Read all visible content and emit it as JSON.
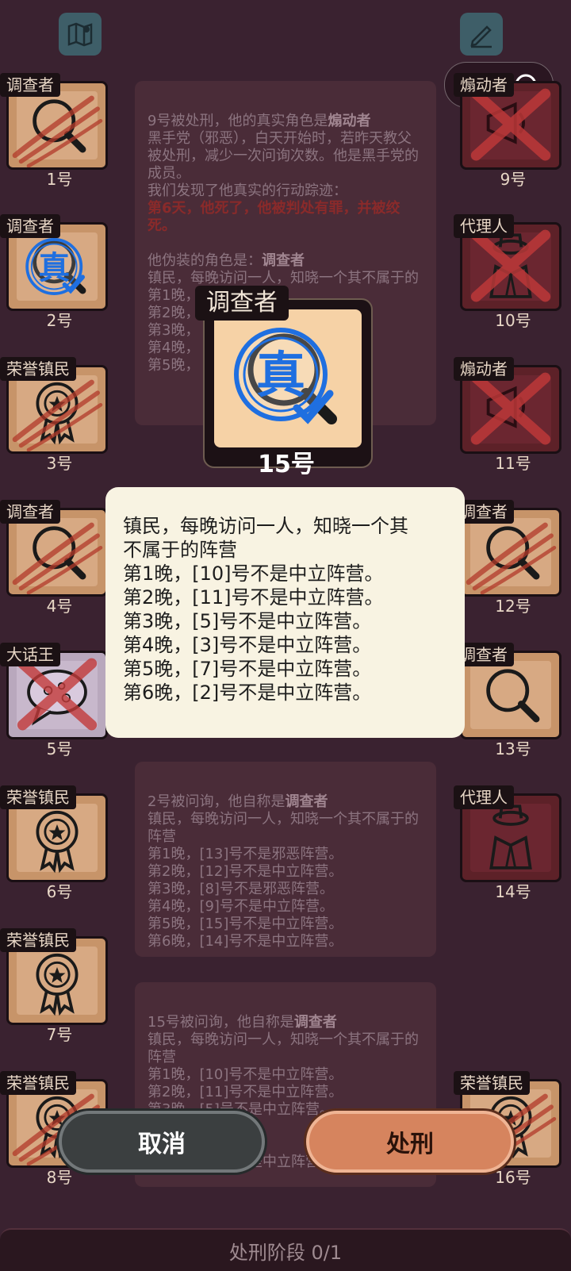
{
  "top_icons": {
    "map": "map-icon",
    "notes": "pen-note-icon"
  },
  "capsule": {
    "menu": "more-dots-icon",
    "close": "target-close-icon"
  },
  "players": [
    {
      "id": "p1",
      "role": "调查者",
      "number": "1号",
      "card": "normal",
      "icon": "magnifier-icon",
      "marked": "scratch"
    },
    {
      "id": "p2",
      "role": "调查者",
      "number": "2号",
      "card": "normal",
      "icon": "magnifier-icon",
      "marked": "true-stamp"
    },
    {
      "id": "p3",
      "role": "荣誉镇民",
      "number": "3号",
      "card": "normal",
      "icon": "medal-icon",
      "marked": "scratch"
    },
    {
      "id": "p4",
      "role": "调查者",
      "number": "4号",
      "card": "normal",
      "icon": "magnifier-icon",
      "marked": "scratch"
    },
    {
      "id": "p5",
      "role": "大话王",
      "number": "5号",
      "card": "purple",
      "icon": "speech-bubble-icon",
      "marked": "cross"
    },
    {
      "id": "p6",
      "role": "荣誉镇民",
      "number": "6号",
      "card": "normal",
      "icon": "medal-icon",
      "marked": "none"
    },
    {
      "id": "p7",
      "role": "荣誉镇民",
      "number": "7号",
      "card": "normal",
      "icon": "medal-icon",
      "marked": "none"
    },
    {
      "id": "p8",
      "role": "荣誉镇民",
      "number": "8号",
      "card": "normal",
      "icon": "medal-icon",
      "marked": "scratch"
    },
    {
      "id": "p9",
      "role": "煽动者",
      "number": "9号",
      "card": "dark",
      "icon": "megaphone-icon",
      "marked": "cross"
    },
    {
      "id": "p10",
      "role": "代理人",
      "number": "10号",
      "card": "dark",
      "icon": "agent-icon",
      "marked": "cross"
    },
    {
      "id": "p11",
      "role": "煽动者",
      "number": "11号",
      "card": "dark",
      "icon": "megaphone-icon",
      "marked": "cross"
    },
    {
      "id": "p12",
      "role": "调查者",
      "number": "12号",
      "card": "normal",
      "icon": "magnifier-icon",
      "marked": "scratch"
    },
    {
      "id": "p13",
      "role": "调查者",
      "number": "13号",
      "card": "normal",
      "icon": "magnifier-icon",
      "marked": "none"
    },
    {
      "id": "p14",
      "role": "代理人",
      "number": "14号",
      "card": "dark",
      "icon": "agent-icon",
      "marked": "none"
    },
    {
      "id": "p16",
      "role": "荣誉镇民",
      "number": "16号",
      "card": "normal",
      "icon": "medal-icon",
      "marked": "scratch"
    }
  ],
  "focus": {
    "role": "调查者",
    "number": "15号",
    "stamp_text": "真"
  },
  "logs": {
    "top": {
      "line1_pre": "9号被处刑，他的真实角色是",
      "line1_role": "煽动者",
      "body": "黑手党（邪恶），白天开始时，若昨天教父被处刑，减少一次问询次数。他是黑手党的成员。\n我们发现了他真实的行动踪迹：",
      "red": "第6天，他死了，他被判处有罪，并被绞死。",
      "disguise_pre": "他伪装的角色是：",
      "disguise_role": "调查者",
      "tail": "镇民，每晚访问一人，知晓一个其不属于的\n第1晚，\n第2晚，\n第3晚，\n第4晚，\n第5晚，"
    },
    "mid": {
      "head_pre": "2号被问询，他自称是",
      "head_role": "调查者",
      "body": "镇民，每晚访问一人，知晓一个其不属于的阵营\n第1晚，[13]号不是邪恶阵营。\n第2晚，[12]号不是中立阵营。\n第3晚，[8]号不是邪恶阵营。\n第4晚，[9]号不是中立阵营。\n第5晚，[15]号不是中立阵营。\n第6晚，[14]号不是中立阵营。"
    },
    "bottom": {
      "head_pre": "15号被问询，他自称是",
      "head_role": "调查者",
      "body": "镇民，每晚访问一人，知晓一个其不属于的阵营\n第1晚，[10]号不是中立阵营。\n第2晚，[11]号不是中立阵营。\n第3晚，[5]号不是中立阵营。\n第4晚，\n第5晚，\n第6晚，[2]号不是中立阵营。"
    }
  },
  "popup": {
    "lines": [
      "镇民，每晚访问一人，知晓一个其",
      "不属于的阵营",
      "第1晚，[10]号不是中立阵营。",
      "第2晚，[11]号不是中立阵营。",
      "第3晚，[5]号不是中立阵营。",
      "第4晚，[3]号不是中立阵营。",
      "第5晚，[7]号不是中立阵营。",
      "第6晚，[2]号不是中立阵营。"
    ]
  },
  "buttons": {
    "cancel": "取消",
    "execute": "处刑"
  },
  "phase": "处刑阶段 0/1",
  "colors": {
    "background": "#3a2230",
    "card": "#c79469",
    "evil_card": "#5d2128",
    "stamp_blue": "#1f6fe0",
    "popup": "#f8f3e2",
    "execute": "#d6845e"
  }
}
